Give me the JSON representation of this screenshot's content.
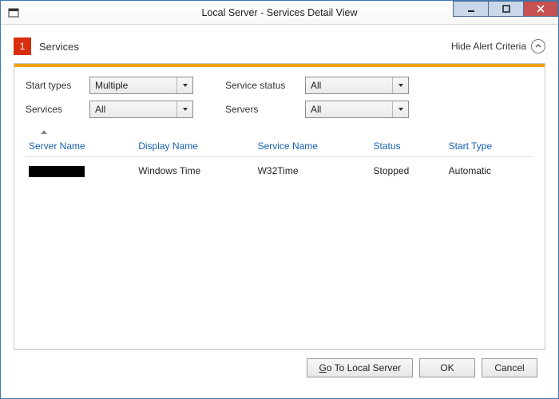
{
  "window": {
    "title": "Local Server - Services Detail View"
  },
  "alert": {
    "count": "1",
    "label": "Services",
    "toggle_label": "Hide Alert Criteria"
  },
  "filters": {
    "start_types": {
      "label": "Start types",
      "value": "Multiple"
    },
    "service_status": {
      "label": "Service status",
      "value": "All"
    },
    "services": {
      "label": "Services",
      "value": "All"
    },
    "servers": {
      "label": "Servers",
      "value": "All"
    }
  },
  "columns": {
    "server_name": "Server Name",
    "display_name": "Display Name",
    "service_name": "Service Name",
    "status": "Status",
    "start_type": "Start Type"
  },
  "rows": [
    {
      "server_name": "",
      "display_name": "Windows Time",
      "service_name": "W32Time",
      "status": "Stopped",
      "start_type": "Automatic"
    }
  ],
  "buttons": {
    "go_local_pre": "G",
    "go_local_post": "o To Local Server",
    "ok": "OK",
    "cancel": "Cancel"
  }
}
